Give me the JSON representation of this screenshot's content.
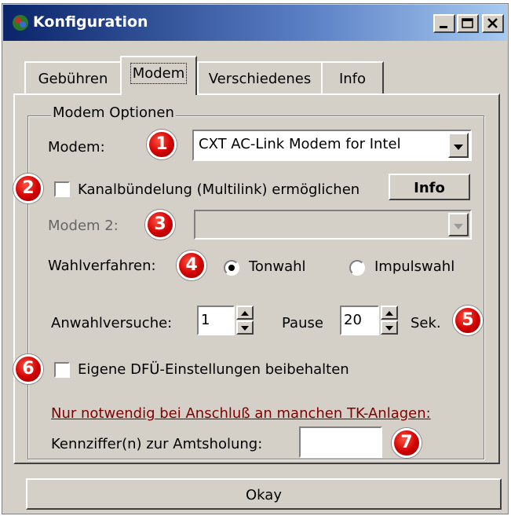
{
  "window": {
    "title": "Konfiguration"
  },
  "tabs": [
    {
      "label": "Gebühren",
      "active": false
    },
    {
      "label": "Modem",
      "active": true
    },
    {
      "label": "Verschiedenes",
      "active": false
    },
    {
      "label": "Info",
      "active": false
    }
  ],
  "group": {
    "label": "Modem Optionen"
  },
  "modem": {
    "label": "Modem:",
    "value": "CXT AC-Link Modem for Intel"
  },
  "multilink": {
    "label": "Kanalbündelung (Multilink) ermöglichen",
    "checked": false,
    "info_button": "Info"
  },
  "modem2": {
    "label": "Modem 2:",
    "value": ""
  },
  "dial": {
    "label": "Wahlverfahren:",
    "tone": "Tonwahl",
    "pulse": "Impulswahl",
    "selected": "Tonwahl"
  },
  "retries": {
    "label": "Anwahlversuche:",
    "value": "1",
    "pause_label": "Pause",
    "pause_value": "20",
    "unit": "Sek."
  },
  "dun": {
    "label": "Eigene DFÜ-Einstellungen beibehalten",
    "checked": false
  },
  "note": "Nur notwendig bei Anschluß an manchen TK-Anlagen:",
  "prefix": {
    "label": "Kennziffer(n) zur Amtsholung:",
    "value": ""
  },
  "ok_button": "Okay",
  "badges": [
    "1",
    "2",
    "3",
    "4",
    "5",
    "6",
    "7"
  ],
  "colors": {
    "titlebar": "#0a246a",
    "badge": "#d00000",
    "note": "#800000",
    "face": "#d4d0c8"
  }
}
